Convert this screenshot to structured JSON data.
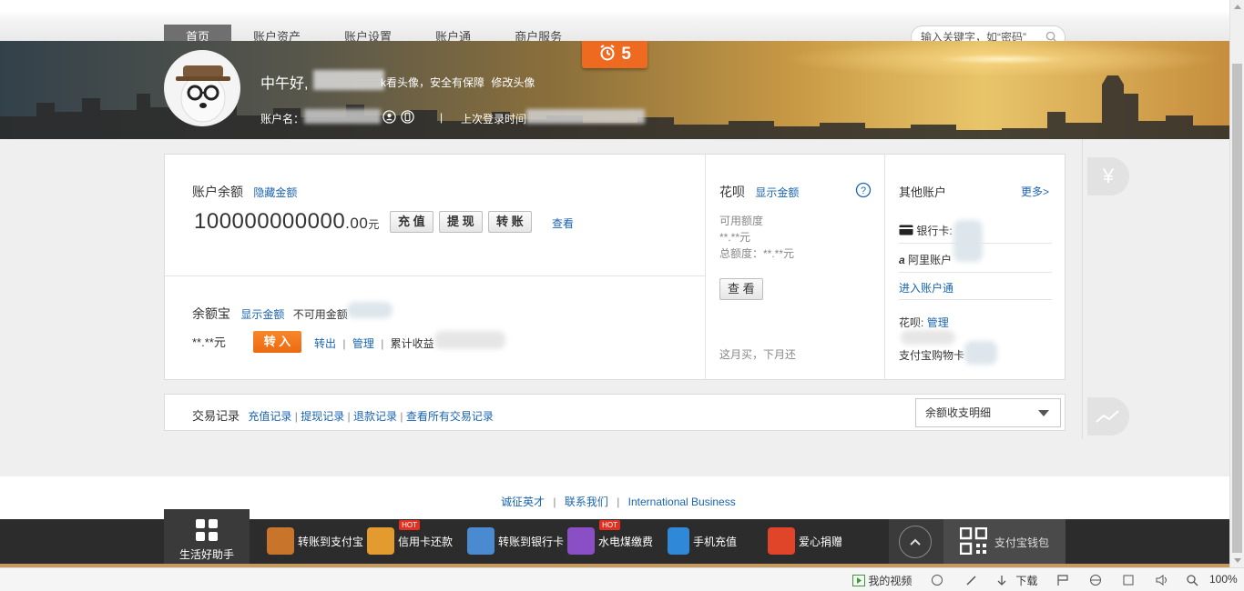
{
  "nav": {
    "items": [
      "首页",
      "账户资产",
      "账户设置",
      "账户通",
      "商户服务"
    ],
    "search_placeholder": "输入关键字，如“密码”"
  },
  "banner": {
    "greeting": "中午好,",
    "avatar_tip": "k看头像，安全有保障",
    "avatar_link": "修改头像",
    "account_label": "账户名：",
    "separator": "|",
    "last_login": "上次登录时间",
    "alarm_count": "5"
  },
  "balance": {
    "title": "账户余额",
    "toggle": "隐藏金额",
    "amount_main": "100000000000",
    "amount_decimal": ".00",
    "currency": "元",
    "btn_recharge": "充 值",
    "btn_withdraw": "提 现",
    "btn_transfer": "转 账",
    "view_link": "查看"
  },
  "yuebao": {
    "title": "余额宝",
    "show_amount": "显示金额",
    "unavailable": "不可用金额",
    "amount": "**.**元",
    "btn_in": "转 入",
    "out": "转出",
    "manage": "管理",
    "cumulative": "累计收益",
    "sep": "|"
  },
  "huabei": {
    "title": "花呗",
    "show_amount": "显示金额",
    "available_label": "可用额度",
    "available_value": "**.**元",
    "total": "总额度：**.**元",
    "btn_view": "查 看",
    "slogan": "这月买，下月还"
  },
  "other": {
    "title": "其他账户",
    "more": "更多>",
    "bank_card": "银行卡:",
    "ali_account": "阿里账户",
    "enter_link": "进入账户通",
    "huabei_label": "花呗:",
    "huabei_manage": "管理",
    "shopping_card": "支付宝购物卡"
  },
  "side": {
    "yen": "¥"
  },
  "transactions": {
    "title": "交易记录",
    "links": [
      "充值记录",
      "提现记录",
      "退款记录",
      "查看所有交易记录"
    ],
    "sep": "|",
    "select_value": "余额收支明细"
  },
  "footer": {
    "links": [
      "诚征英才",
      "联系我们",
      "International Business"
    ],
    "sep": "|"
  },
  "toolbar": {
    "life_label": "生活好助手",
    "items": [
      "转账到支付宝",
      "信用卡还款",
      "转账到银行卡",
      "水电煤缴费",
      "手机充值",
      "爱心捐赠"
    ],
    "hot": "HOT",
    "wallet": "支付宝钱包"
  },
  "statusbar": {
    "video": "我的视频",
    "download": "下载",
    "zoom": "100%"
  },
  "colors": {
    "link": "#1a64b0",
    "orange": "#ef6a21",
    "toolbar": "#2c2c2c"
  }
}
